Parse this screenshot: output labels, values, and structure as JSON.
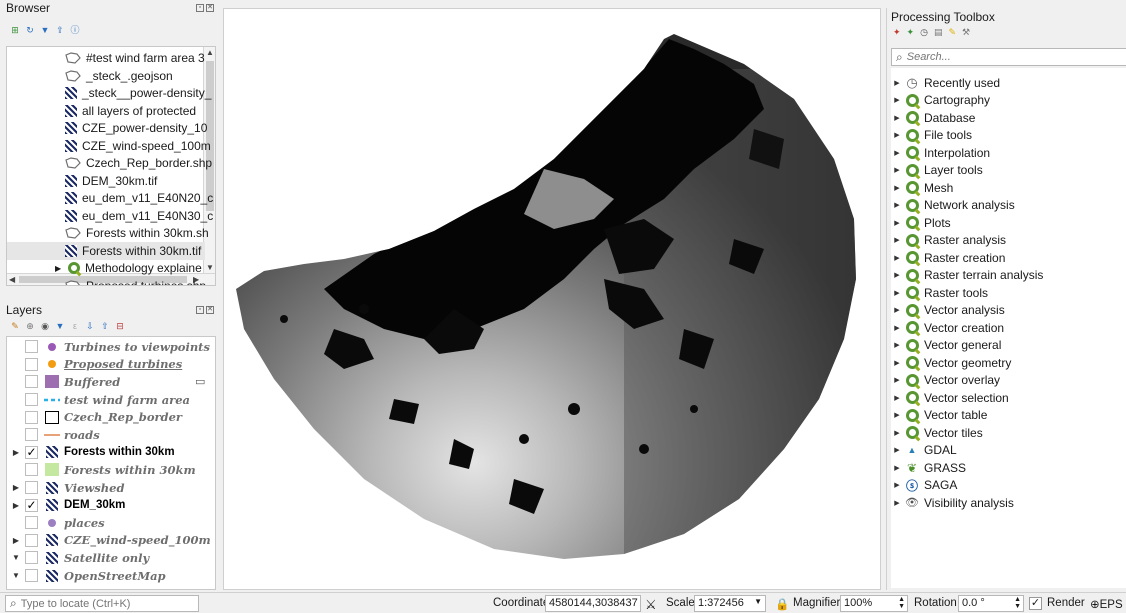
{
  "browser": {
    "title": "Browser",
    "items": [
      {
        "label": "#test wind farm area 3",
        "type": "vector"
      },
      {
        "label": "_steck_.geojson",
        "type": "vector"
      },
      {
        "label": "_steck__power-density_",
        "type": "raster"
      },
      {
        "label": "all layers of protected",
        "type": "raster"
      },
      {
        "label": "CZE_power-density_10",
        "type": "raster"
      },
      {
        "label": "CZE_wind-speed_100m",
        "type": "raster"
      },
      {
        "label": "Czech_Rep_border.shp",
        "type": "vector"
      },
      {
        "label": "DEM_30km.tif",
        "type": "raster"
      },
      {
        "label": "eu_dem_v11_E40N20_c",
        "type": "raster"
      },
      {
        "label": "eu_dem_v11_E40N30_c",
        "type": "raster"
      },
      {
        "label": "Forests within 30km.sh",
        "type": "vector"
      },
      {
        "label": "Forests within 30km.tif",
        "type": "raster"
      },
      {
        "label": "Methodology explaine",
        "type": "project"
      },
      {
        "label": "Proposed turbines.shp",
        "type": "vector"
      }
    ]
  },
  "layers": {
    "title": "Layers",
    "items": [
      {
        "label": "Turbines to viewpoints",
        "symbol": "dot",
        "color": "#9b59b6",
        "checked": false,
        "expand": ""
      },
      {
        "label": "Proposed turbines",
        "symbol": "dot",
        "color": "#f39c12",
        "checked": false,
        "expand": "",
        "underline": true
      },
      {
        "label": "Buffered",
        "symbol": "fill",
        "color": "#9e6fb0",
        "checked": false,
        "expand": ""
      },
      {
        "label": "test wind farm area",
        "symbol": "dash",
        "color": "#2ab0e6",
        "checked": false,
        "expand": ""
      },
      {
        "label": "Czech_Rep_border",
        "symbol": "outline",
        "color": "#000000",
        "checked": false,
        "expand": ""
      },
      {
        "label": "roads",
        "symbol": "line",
        "color": "#e8a27a",
        "checked": false,
        "expand": ""
      },
      {
        "label": "Forests within 30km",
        "symbol": "raster",
        "color": "",
        "checked": true,
        "expand": "▶"
      },
      {
        "label": "Forests within 30km",
        "symbol": "fill",
        "color": "#c5e8a0",
        "checked": false,
        "expand": ""
      },
      {
        "label": "Viewshed",
        "symbol": "raster",
        "color": "",
        "checked": false,
        "expand": "▶"
      },
      {
        "label": "DEM_30km",
        "symbol": "raster",
        "color": "",
        "checked": true,
        "expand": "▶"
      },
      {
        "label": "places",
        "symbol": "dot",
        "color": "#9b7fc0",
        "checked": false,
        "expand": ""
      },
      {
        "label": "CZE_wind-speed_100m",
        "symbol": "raster",
        "color": "",
        "checked": false,
        "expand": "▶"
      },
      {
        "label": "Satellite only",
        "symbol": "raster",
        "color": "",
        "checked": false,
        "expand": "▼"
      },
      {
        "label": "OpenStreetMap",
        "symbol": "raster",
        "color": "",
        "checked": false,
        "expand": "▼"
      }
    ]
  },
  "toolbox": {
    "title": "Processing Toolbox",
    "search_placeholder": "Search...",
    "items": [
      {
        "label": "Recently used",
        "icon": "clock-icon"
      },
      {
        "label": "Cartography",
        "icon": "qgis-icon"
      },
      {
        "label": "Database",
        "icon": "qgis-icon"
      },
      {
        "label": "File tools",
        "icon": "qgis-icon"
      },
      {
        "label": "Interpolation",
        "icon": "qgis-icon"
      },
      {
        "label": "Layer tools",
        "icon": "qgis-icon"
      },
      {
        "label": "Mesh",
        "icon": "qgis-icon"
      },
      {
        "label": "Network analysis",
        "icon": "qgis-icon"
      },
      {
        "label": "Plots",
        "icon": "qgis-icon"
      },
      {
        "label": "Raster analysis",
        "icon": "qgis-icon"
      },
      {
        "label": "Raster creation",
        "icon": "qgis-icon"
      },
      {
        "label": "Raster terrain analysis",
        "icon": "qgis-icon"
      },
      {
        "label": "Raster tools",
        "icon": "qgis-icon"
      },
      {
        "label": "Vector analysis",
        "icon": "qgis-icon"
      },
      {
        "label": "Vector creation",
        "icon": "qgis-icon"
      },
      {
        "label": "Vector general",
        "icon": "qgis-icon"
      },
      {
        "label": "Vector geometry",
        "icon": "qgis-icon"
      },
      {
        "label": "Vector overlay",
        "icon": "qgis-icon"
      },
      {
        "label": "Vector selection",
        "icon": "qgis-icon"
      },
      {
        "label": "Vector table",
        "icon": "qgis-icon"
      },
      {
        "label": "Vector tiles",
        "icon": "qgis-icon"
      },
      {
        "label": "GDAL",
        "icon": "gdal-icon"
      },
      {
        "label": "GRASS",
        "icon": "grass-icon"
      },
      {
        "label": "SAGA",
        "icon": "saga-icon"
      },
      {
        "label": "Visibility analysis",
        "icon": "eye-icon"
      }
    ]
  },
  "statusbar": {
    "locate_placeholder": "Type to locate (Ctrl+K)",
    "coordinate_label": "Coordinate",
    "coordinate_value": "4580144,3038437",
    "scale_label": "Scale",
    "scale_value": "1:372456",
    "magnifier_label": "Magnifier",
    "magnifier_value": "100%",
    "rotation_label": "Rotation",
    "rotation_value": "0.0 °",
    "render_label": "Render",
    "crs_label": "EPS"
  }
}
